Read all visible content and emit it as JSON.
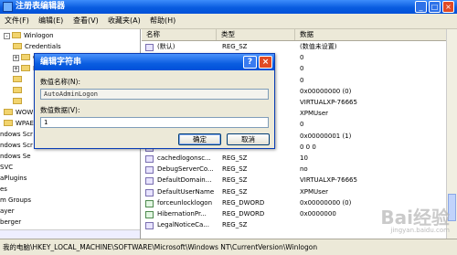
{
  "window": {
    "title": "注册表编辑器",
    "minimize": "_",
    "maximize": "□",
    "close": "×"
  },
  "menu": [
    "文件(F)",
    "编辑(E)",
    "查看(V)",
    "收藏夹(A)",
    "帮助(H)"
  ],
  "tree": [
    {
      "label": "Winlogon",
      "indent": 0,
      "expander": "-"
    },
    {
      "label": "Credentials",
      "indent": 1,
      "expander": ""
    },
    {
      "label": "G",
      "indent": 1,
      "expander": "+"
    },
    {
      "label": "N",
      "indent": 1,
      "expander": "+"
    },
    {
      "label": "",
      "indent": 1,
      "expander": ""
    },
    {
      "label": "",
      "indent": 1,
      "expander": ""
    },
    {
      "label": "",
      "indent": 1,
      "expander": ""
    },
    {
      "label": "WOW",
      "indent": 0,
      "expander": ""
    },
    {
      "label": "WPAE",
      "indent": 0,
      "expander": ""
    },
    {
      "label": "ndows Scr",
      "indent": -1,
      "expander": ""
    },
    {
      "label": "ndows Scr",
      "indent": -1,
      "expander": ""
    },
    {
      "label": "ndows Se",
      "indent": -1,
      "expander": ""
    },
    {
      "label": "SVC",
      "indent": -1,
      "expander": ""
    },
    {
      "label": "aPlugins",
      "indent": -1,
      "expander": ""
    },
    {
      "label": "es",
      "indent": -1,
      "expander": ""
    },
    {
      "label": "m Groups",
      "indent": -1,
      "expander": ""
    },
    {
      "label": "ayer",
      "indent": -1,
      "expander": ""
    },
    {
      "label": "berger",
      "indent": -1,
      "expander": ""
    }
  ],
  "list": {
    "headers": [
      "名称",
      "类型",
      "数据"
    ],
    "rows": [
      {
        "name": "(默认)",
        "type": "REG_SZ",
        "data": "(数值未设置)",
        "icon": "string"
      },
      {
        "name": "",
        "type": "",
        "data": "0",
        "icon": "string"
      },
      {
        "name": "",
        "type": "",
        "data": "0",
        "icon": "string"
      },
      {
        "name": "",
        "type": "",
        "data": "0",
        "icon": "string"
      },
      {
        "name": "",
        "type": "",
        "data": "0x00000000 (0)",
        "icon": "binary"
      },
      {
        "name": "",
        "type": "",
        "data": "VIRTUALXP-76665",
        "icon": "string"
      },
      {
        "name": "",
        "type": "",
        "data": "XPMUser",
        "icon": "string"
      },
      {
        "name": "",
        "type": "",
        "data": "0",
        "icon": "string"
      },
      {
        "name": "",
        "type": "",
        "data": "0x00000001 (1)",
        "icon": "binary"
      },
      {
        "name": "",
        "type": "",
        "data": "0 0 0",
        "icon": "string"
      },
      {
        "name": "cachedlogonsc...",
        "type": "REG_SZ",
        "data": "10",
        "icon": "string"
      },
      {
        "name": "DebugServerCo...",
        "type": "REG_SZ",
        "data": "no",
        "icon": "string"
      },
      {
        "name": "DefaultDomain...",
        "type": "REG_SZ",
        "data": "VIRTUALXP-76665",
        "icon": "string"
      },
      {
        "name": "DefaultUserName",
        "type": "REG_SZ",
        "data": "XPMUser",
        "icon": "string"
      },
      {
        "name": "forceunlocklogon",
        "type": "REG_DWORD",
        "data": "0x00000000 (0)",
        "icon": "binary"
      },
      {
        "name": "HibernationPr...",
        "type": "REG_DWORD",
        "data": "0x0000000",
        "icon": "binary"
      },
      {
        "name": "LegalNoticeCa...",
        "type": "REG_SZ",
        "data": "",
        "icon": "string"
      }
    ]
  },
  "status": "我的电脑\\HKEY_LOCAL_MACHINE\\SOFTWARE\\Microsoft\\Windows NT\\CurrentVersion\\Winlogon",
  "watermark": "Bai经验",
  "watermark_url": "jingyan.baidu.com",
  "dialog": {
    "title": "编辑字符串",
    "help": "?",
    "close": "×",
    "name_label": "数值名称(N):",
    "name_value": "AutoAdminLogon",
    "data_label": "数值数据(V):",
    "data_value": "1",
    "ok": "确定",
    "cancel": "取消"
  }
}
